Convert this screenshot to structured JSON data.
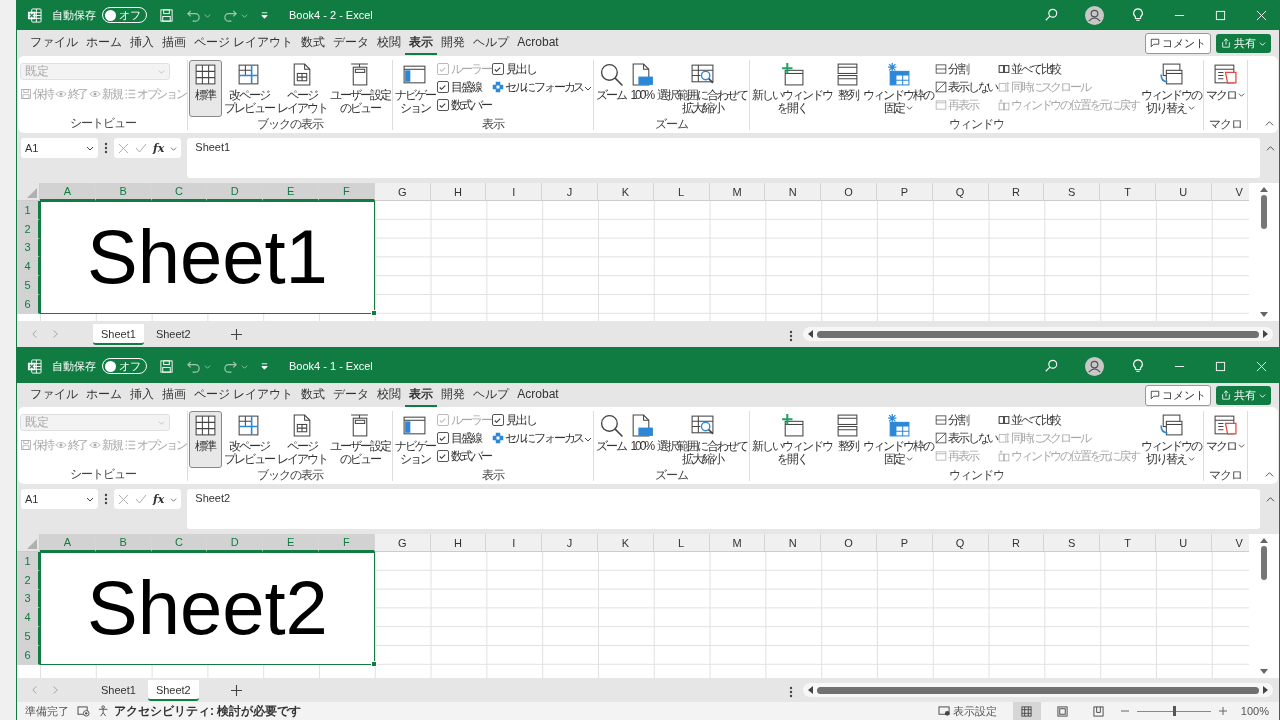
{
  "windows": [
    {
      "title_bar": {
        "autosave_label": "自動保存",
        "autosave_toggle": {
          "label": "オフ",
          "on": false
        },
        "title": "Book4 - 2 - Excel"
      },
      "menu_tabs": [
        {
          "label": "ファイル",
          "selected": false
        },
        {
          "label": "ホーム",
          "selected": false
        },
        {
          "label": "挿入",
          "selected": false
        },
        {
          "label": "描画",
          "selected": false
        },
        {
          "label": "ページ レイアウト",
          "selected": false
        },
        {
          "label": "数式",
          "selected": false
        },
        {
          "label": "データ",
          "selected": false
        },
        {
          "label": "校閲",
          "selected": false
        },
        {
          "label": "表示",
          "selected": true
        },
        {
          "label": "開発",
          "selected": false
        },
        {
          "label": "ヘルプ",
          "selected": false
        },
        {
          "label": "Acrobat",
          "selected": false
        }
      ],
      "comment_button": "コメント",
      "share_button": "共有",
      "ribbon": {
        "groups": [
          {
            "label": "シートビュー",
            "rows": [
              [
                {
                  "kind": "dropdown",
                  "label": "既定",
                  "disabled": true
                }
              ],
              [
                {
                  "kind": "small",
                  "label": "保持",
                  "disabled": true
                },
                {
                  "kind": "small",
                  "label": "終了",
                  "disabled": true
                },
                {
                  "kind": "small",
                  "label": "新規",
                  "disabled": true
                },
                {
                  "kind": "small",
                  "label": "オプション",
                  "disabled": true
                }
              ]
            ]
          },
          {
            "label": "ブックの表示",
            "columns": [
              [
                {
                  "kind": "large",
                  "lines": [
                    "標準"
                  ],
                  "selected": true,
                  "disabled": false
                }
              ],
              [
                {
                  "kind": "large",
                  "lines": [
                    "改ページ",
                    "プレビュー"
                  ],
                  "selected": false,
                  "disabled": false
                }
              ],
              [
                {
                  "kind": "large",
                  "lines": [
                    "ページ",
                    "レイアウト"
                  ],
                  "selected": false,
                  "disabled": false
                }
              ],
              [
                {
                  "kind": "large",
                  "lines": [
                    "ユーザー設定",
                    "のビュー"
                  ],
                  "selected": false,
                  "disabled": false
                }
              ]
            ]
          },
          {
            "label": "表示",
            "columns": [
              [
                {
                  "kind": "large",
                  "lines": [
                    "ナビゲー",
                    "ション"
                  ],
                  "disabled": false
                }
              ],
              [
                {
                  "kind": "check",
                  "label": "ルーラー",
                  "checked": true,
                  "disabled": true
                },
                {
                  "kind": "check",
                  "label": "目盛線",
                  "checked": true,
                  "disabled": false
                },
                {
                  "kind": "check",
                  "label": "数式バー",
                  "checked": true,
                  "disabled": false
                }
              ],
              [
                {
                  "kind": "check",
                  "label": "見出し",
                  "checked": true,
                  "disabled": false
                },
                {
                  "kind": "small",
                  "label": "セルにフォーカス",
                  "disabled": false
                }
              ],
              [
                {
                  "kind": "more",
                  "disabled": false
                }
              ]
            ]
          },
          {
            "label": "ズーム",
            "columns": [
              [
                {
                  "kind": "large",
                  "lines": [
                    "ズーム"
                  ],
                  "disabled": false
                }
              ],
              [
                {
                  "kind": "large",
                  "lines": [
                    "100%"
                  ],
                  "disabled": false
                }
              ],
              [
                {
                  "kind": "large",
                  "lines": [
                    "選択範囲に合わせて",
                    "拡大/縮小"
                  ],
                  "disabled": false
                }
              ]
            ]
          },
          {
            "label": "ウィンドウ",
            "columns": [
              [
                {
                  "kind": "large",
                  "lines": [
                    "新しいウィンドウ",
                    "を開く"
                  ],
                  "disabled": false
                }
              ],
              [
                {
                  "kind": "large",
                  "lines": [
                    "整列"
                  ],
                  "disabled": false
                }
              ],
              [
                {
                  "kind": "large-menu",
                  "lines": [
                    "ウィンドウ枠の",
                    "固定"
                  ],
                  "disabled": false
                }
              ],
              [
                {
                  "kind": "small",
                  "label": "分割",
                  "disabled": false
                },
                {
                  "kind": "small",
                  "label": "表示しない",
                  "disabled": false
                },
                {
                  "kind": "small",
                  "label": "再表示",
                  "disabled": true
                }
              ],
              [
                {
                  "kind": "small",
                  "label": "並べて比較",
                  "disabled": false
                },
                {
                  "kind": "small",
                  "label": "同時にスクロール",
                  "disabled": true
                },
                {
                  "kind": "small",
                  "label": "ウィンドウの位置を元に戻す",
                  "disabled": true
                }
              ],
              [
                {
                  "kind": "large-menu",
                  "lines": [
                    "ウィンドウの",
                    "切り替え"
                  ],
                  "disabled": false
                }
              ]
            ]
          },
          {
            "label": "マクロ",
            "columns": [
              [
                {
                  "kind": "large-menu",
                  "lines": [
                    "マクロ"
                  ],
                  "disabled": false
                }
              ]
            ]
          }
        ]
      },
      "formula_bar": {
        "name_box": "A1",
        "fx_label": "fx",
        "value": "Sheet1"
      },
      "sheet": {
        "columns": [
          {
            "label": "A",
            "selected": true
          },
          {
            "label": "B",
            "selected": true
          },
          {
            "label": "C",
            "selected": true
          },
          {
            "label": "D",
            "selected": true
          },
          {
            "label": "E",
            "selected": true
          },
          {
            "label": "F",
            "selected": true
          },
          {
            "label": "G",
            "selected": false
          },
          {
            "label": "H",
            "selected": false
          },
          {
            "label": "I",
            "selected": false
          },
          {
            "label": "J",
            "selected": false
          },
          {
            "label": "K",
            "selected": false
          },
          {
            "label": "L",
            "selected": false
          },
          {
            "label": "M",
            "selected": false
          },
          {
            "label": "N",
            "selected": false
          },
          {
            "label": "O",
            "selected": false
          },
          {
            "label": "P",
            "selected": false
          },
          {
            "label": "Q",
            "selected": false
          },
          {
            "label": "R",
            "selected": false
          },
          {
            "label": "S",
            "selected": false
          },
          {
            "label": "T",
            "selected": false
          },
          {
            "label": "U",
            "selected": false
          },
          {
            "label": "V",
            "selected": false
          }
        ],
        "rows": [
          {
            "label": "1",
            "selected": true
          },
          {
            "label": "2",
            "selected": true
          },
          {
            "label": "3",
            "selected": true
          },
          {
            "label": "4",
            "selected": true
          },
          {
            "label": "5",
            "selected": true
          },
          {
            "label": "6",
            "selected": true
          }
        ],
        "cell_text": "Sheet1"
      },
      "sheet_tabs": [
        {
          "label": "Sheet1",
          "selected": true
        },
        {
          "label": "Sheet2",
          "selected": false
        }
      ]
    },
    {
      "title_bar": {
        "autosave_label": "自動保存",
        "autosave_toggle": {
          "label": "オフ",
          "on": false
        },
        "title": "Book4 - 1 - Excel"
      },
      "menu_tabs": [
        {
          "label": "ファイル",
          "selected": false
        },
        {
          "label": "ホーム",
          "selected": false
        },
        {
          "label": "挿入",
          "selected": false
        },
        {
          "label": "描画",
          "selected": false
        },
        {
          "label": "ページ レイアウト",
          "selected": false
        },
        {
          "label": "数式",
          "selected": false
        },
        {
          "label": "データ",
          "selected": false
        },
        {
          "label": "校閲",
          "selected": false
        },
        {
          "label": "表示",
          "selected": true
        },
        {
          "label": "開発",
          "selected": false
        },
        {
          "label": "ヘルプ",
          "selected": false
        },
        {
          "label": "Acrobat",
          "selected": false
        }
      ],
      "comment_button": "コメント",
      "share_button": "共有",
      "ribbon": {
        "groups": [
          {
            "label": "シートビュー",
            "rows": [
              [
                {
                  "kind": "dropdown",
                  "label": "既定",
                  "disabled": true
                }
              ],
              [
                {
                  "kind": "small",
                  "label": "保持",
                  "disabled": true
                },
                {
                  "kind": "small",
                  "label": "終了",
                  "disabled": true
                },
                {
                  "kind": "small",
                  "label": "新規",
                  "disabled": true
                },
                {
                  "kind": "small",
                  "label": "オプション",
                  "disabled": true
                }
              ]
            ]
          },
          {
            "label": "ブックの表示",
            "columns": [
              [
                {
                  "kind": "large",
                  "lines": [
                    "標準"
                  ],
                  "selected": true,
                  "disabled": false
                }
              ],
              [
                {
                  "kind": "large",
                  "lines": [
                    "改ページ",
                    "プレビュー"
                  ],
                  "selected": false,
                  "disabled": false
                }
              ],
              [
                {
                  "kind": "large",
                  "lines": [
                    "ページ",
                    "レイアウト"
                  ],
                  "selected": false,
                  "disabled": false
                }
              ],
              [
                {
                  "kind": "large",
                  "lines": [
                    "ユーザー設定",
                    "のビュー"
                  ],
                  "selected": false,
                  "disabled": false
                }
              ]
            ]
          },
          {
            "label": "表示",
            "columns": [
              [
                {
                  "kind": "large",
                  "lines": [
                    "ナビゲー",
                    "ション"
                  ],
                  "disabled": false
                }
              ],
              [
                {
                  "kind": "check",
                  "label": "ルーラー",
                  "checked": true,
                  "disabled": true
                },
                {
                  "kind": "check",
                  "label": "目盛線",
                  "checked": true,
                  "disabled": false
                },
                {
                  "kind": "check",
                  "label": "数式バー",
                  "checked": true,
                  "disabled": false
                }
              ],
              [
                {
                  "kind": "check",
                  "label": "見出し",
                  "checked": true,
                  "disabled": false
                },
                {
                  "kind": "small",
                  "label": "セルにフォーカス",
                  "disabled": false
                }
              ],
              [
                {
                  "kind": "more",
                  "disabled": false
                }
              ]
            ]
          },
          {
            "label": "ズーム",
            "columns": [
              [
                {
                  "kind": "large",
                  "lines": [
                    "ズーム"
                  ],
                  "disabled": false
                }
              ],
              [
                {
                  "kind": "large",
                  "lines": [
                    "100%"
                  ],
                  "disabled": false
                }
              ],
              [
                {
                  "kind": "large",
                  "lines": [
                    "選択範囲に合わせて",
                    "拡大/縮小"
                  ],
                  "disabled": false
                }
              ]
            ]
          },
          {
            "label": "ウィンドウ",
            "columns": [
              [
                {
                  "kind": "large",
                  "lines": [
                    "新しいウィンドウ",
                    "を開く"
                  ],
                  "disabled": false
                }
              ],
              [
                {
                  "kind": "large",
                  "lines": [
                    "整列"
                  ],
                  "disabled": false
                }
              ],
              [
                {
                  "kind": "large-menu",
                  "lines": [
                    "ウィンドウ枠の",
                    "固定"
                  ],
                  "disabled": false
                }
              ],
              [
                {
                  "kind": "small",
                  "label": "分割",
                  "disabled": false
                },
                {
                  "kind": "small",
                  "label": "表示しない",
                  "disabled": false
                },
                {
                  "kind": "small",
                  "label": "再表示",
                  "disabled": true
                }
              ],
              [
                {
                  "kind": "small",
                  "label": "並べて比較",
                  "disabled": false
                },
                {
                  "kind": "small",
                  "label": "同時にスクロール",
                  "disabled": true
                },
                {
                  "kind": "small",
                  "label": "ウィンドウの位置を元に戻す",
                  "disabled": true
                }
              ],
              [
                {
                  "kind": "large-menu",
                  "lines": [
                    "ウィンドウの",
                    "切り替え"
                  ],
                  "disabled": false
                }
              ]
            ]
          },
          {
            "label": "マクロ",
            "columns": [
              [
                {
                  "kind": "large-menu",
                  "lines": [
                    "マクロ"
                  ],
                  "disabled": false
                }
              ]
            ]
          }
        ]
      },
      "formula_bar": {
        "name_box": "A1",
        "fx_label": "fx",
        "value": "Sheet2"
      },
      "sheet": {
        "columns": [
          {
            "label": "A",
            "selected": true
          },
          {
            "label": "B",
            "selected": true
          },
          {
            "label": "C",
            "selected": true
          },
          {
            "label": "D",
            "selected": true
          },
          {
            "label": "E",
            "selected": true
          },
          {
            "label": "F",
            "selected": true
          },
          {
            "label": "G",
            "selected": false
          },
          {
            "label": "H",
            "selected": false
          },
          {
            "label": "I",
            "selected": false
          },
          {
            "label": "J",
            "selected": false
          },
          {
            "label": "K",
            "selected": false
          },
          {
            "label": "L",
            "selected": false
          },
          {
            "label": "M",
            "selected": false
          },
          {
            "label": "N",
            "selected": false
          },
          {
            "label": "O",
            "selected": false
          },
          {
            "label": "P",
            "selected": false
          },
          {
            "label": "Q",
            "selected": false
          },
          {
            "label": "R",
            "selected": false
          },
          {
            "label": "S",
            "selected": false
          },
          {
            "label": "T",
            "selected": false
          },
          {
            "label": "U",
            "selected": false
          },
          {
            "label": "V",
            "selected": false
          }
        ],
        "rows": [
          {
            "label": "1",
            "selected": true
          },
          {
            "label": "2",
            "selected": true
          },
          {
            "label": "3",
            "selected": true
          },
          {
            "label": "4",
            "selected": true
          },
          {
            "label": "5",
            "selected": true
          },
          {
            "label": "6",
            "selected": true
          }
        ],
        "cell_text": "Sheet2"
      },
      "sheet_tabs": [
        {
          "label": "Sheet1",
          "selected": false
        },
        {
          "label": "Sheet2",
          "selected": true
        }
      ],
      "status_bar": {
        "ready": "準備完了",
        "accessibility": "アクセシビリティ: 検討が必要です",
        "display_settings": "表示設定",
        "views": [
          {
            "selected": true
          },
          {
            "selected": false
          },
          {
            "selected": false
          }
        ],
        "zoom": {
          "level": 0.5,
          "reading": "100%"
        }
      }
    }
  ]
}
